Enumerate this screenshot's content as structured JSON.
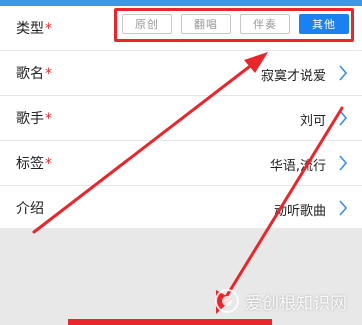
{
  "header": {
    "title": ""
  },
  "form": {
    "type": {
      "label": "类型",
      "required_mark": "*",
      "options": [
        "原创",
        "翻唱",
        "伴奏",
        "其他"
      ],
      "selected": "其他"
    },
    "song": {
      "label": "歌名",
      "required_mark": "*",
      "value": "寂寞才说爱"
    },
    "singer": {
      "label": "歌手",
      "required_mark": "*",
      "value": "刘可"
    },
    "tags": {
      "label": "标签",
      "required_mark": "*",
      "value": "华语,流行"
    },
    "intro": {
      "label": "介绍",
      "value": "动听歌曲"
    }
  },
  "watermark": {
    "text": "爱创根知识网"
  },
  "colors": {
    "accent": "#1a82f0",
    "required": "#e2292c",
    "annotation": "#e8262c",
    "chevron": "#3a8ee8"
  }
}
